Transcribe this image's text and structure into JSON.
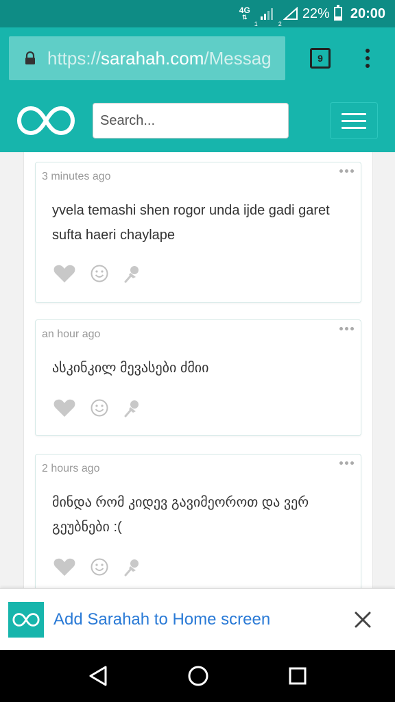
{
  "status": {
    "network": "4G",
    "sim1": "1",
    "sim2": "2",
    "battery": "22%",
    "battery_level": 0.22,
    "time": "20:00"
  },
  "browser": {
    "url_scheme": "https://",
    "url_host": "sarahah.com",
    "url_path": "/Messag",
    "tab_count": "9"
  },
  "header": {
    "search_placeholder": "Search..."
  },
  "messages": [
    {
      "time": "3 minutes ago",
      "text": "yvela temashi shen rogor unda ijde gadi garet sufta haeri chaylape"
    },
    {
      "time": "an hour ago",
      "text": "ასკინკილ მევასები ძმიი"
    },
    {
      "time": "2 hours ago",
      "text": "მინდა რომ კიდევ გავიმეოროთ და ვერ გეუბნები :("
    }
  ],
  "banner": {
    "label": "Add Sarahah to Home screen"
  },
  "colors": {
    "brand": "#17b5ac",
    "status_bar": "#0e8c85",
    "link": "#2a7ad6"
  }
}
